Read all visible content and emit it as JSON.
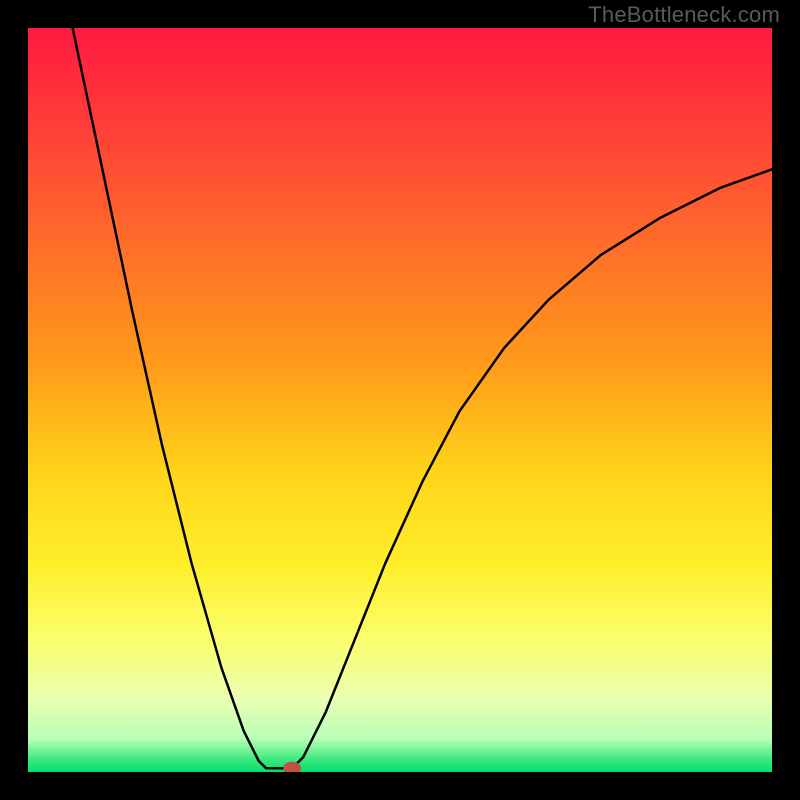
{
  "watermark": "TheBottleneck.com",
  "chart_data": {
    "type": "line",
    "title": "",
    "xlabel": "",
    "ylabel": "",
    "xlim": [
      0,
      100
    ],
    "ylim": [
      0,
      100
    ],
    "gradient_stops": [
      {
        "offset": 0.0,
        "color": "#ff1a3f"
      },
      {
        "offset": 0.12,
        "color": "#ff3a3a"
      },
      {
        "offset": 0.28,
        "color": "#ff6a2a"
      },
      {
        "offset": 0.45,
        "color": "#ff9a1a"
      },
      {
        "offset": 0.6,
        "color": "#ffd51a"
      },
      {
        "offset": 0.72,
        "color": "#ffee2a"
      },
      {
        "offset": 0.82,
        "color": "#faff6a"
      },
      {
        "offset": 0.9,
        "color": "#eaffb0"
      },
      {
        "offset": 0.955,
        "color": "#b8ffb8"
      },
      {
        "offset": 0.985,
        "color": "#35e87a"
      },
      {
        "offset": 1.0,
        "color": "#00e070"
      }
    ],
    "curve_left": [
      {
        "x": 6.0,
        "y": 100.0
      },
      {
        "x": 10.0,
        "y": 81.0
      },
      {
        "x": 14.0,
        "y": 62.0
      },
      {
        "x": 18.0,
        "y": 44.0
      },
      {
        "x": 22.0,
        "y": 28.0
      },
      {
        "x": 26.0,
        "y": 14.0
      },
      {
        "x": 29.0,
        "y": 5.5
      },
      {
        "x": 31.0,
        "y": 1.5
      },
      {
        "x": 32.0,
        "y": 0.5
      }
    ],
    "flat_segment": [
      {
        "x": 32.0,
        "y": 0.5
      },
      {
        "x": 35.5,
        "y": 0.5
      }
    ],
    "curve_right": [
      {
        "x": 35.5,
        "y": 0.5
      },
      {
        "x": 37.0,
        "y": 2.0
      },
      {
        "x": 40.0,
        "y": 8.0
      },
      {
        "x": 44.0,
        "y": 18.0
      },
      {
        "x": 48.0,
        "y": 28.0
      },
      {
        "x": 53.0,
        "y": 39.0
      },
      {
        "x": 58.0,
        "y": 48.5
      },
      {
        "x": 64.0,
        "y": 57.0
      },
      {
        "x": 70.0,
        "y": 63.5
      },
      {
        "x": 77.0,
        "y": 69.5
      },
      {
        "x": 85.0,
        "y": 74.5
      },
      {
        "x": 93.0,
        "y": 78.5
      },
      {
        "x": 100.0,
        "y": 81.0
      }
    ],
    "marker": {
      "x": 35.5,
      "y": 0.5,
      "rx": 1.2,
      "ry": 0.9,
      "color": "#c05040"
    },
    "curve_color": "#000000",
    "curve_width": 2.5
  }
}
